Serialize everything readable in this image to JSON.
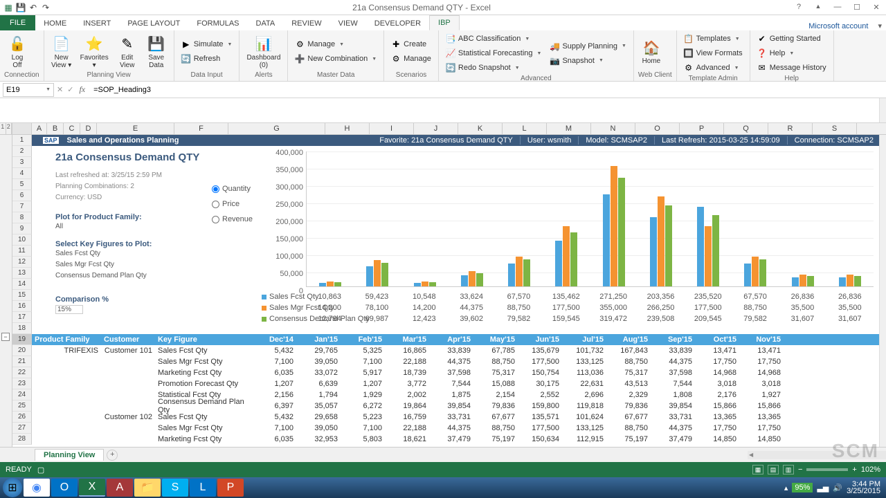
{
  "app": {
    "title": "21a Consensus Demand QTY - Excel",
    "account": "Microsoft account"
  },
  "qat": {
    "save": "💾",
    "undo": "↶",
    "redo": "↷"
  },
  "tabs": [
    "FILE",
    "HOME",
    "INSERT",
    "PAGE LAYOUT",
    "FORMULAS",
    "DATA",
    "REVIEW",
    "VIEW",
    "DEVELOPER",
    "IBP"
  ],
  "ribbon": {
    "groups": [
      {
        "label": "Connection",
        "big": [
          {
            "ic": "🔓",
            "t1": "Log",
            "t2": "Off"
          }
        ]
      },
      {
        "label": "Planning View",
        "big": [
          {
            "ic": "📄",
            "t1": "New",
            "t2": "View ▾"
          },
          {
            "ic": "⭐",
            "t1": "Favorites",
            "t2": "▾"
          },
          {
            "ic": "✎",
            "t1": "Edit",
            "t2": "View"
          },
          {
            "ic": "💾",
            "t1": "Save",
            "t2": "Data"
          }
        ]
      },
      {
        "label": "Data Input",
        "small": [
          {
            "ic": "▶",
            "tx": "Simulate",
            "dd": true
          },
          {
            "ic": "🔄",
            "tx": "Refresh"
          }
        ]
      },
      {
        "label": "Alerts",
        "big": [
          {
            "ic": "📊",
            "t1": "Dashboard",
            "t2": "(0)"
          }
        ]
      },
      {
        "label": "Master Data",
        "small": [
          {
            "ic": "⚙",
            "tx": "Manage",
            "dd": true
          },
          {
            "ic": "➕",
            "tx": "New Combination",
            "dd": true
          }
        ]
      },
      {
        "label": "Scenarios",
        "small": [
          {
            "ic": "✚",
            "tx": "Create"
          },
          {
            "ic": "⚙",
            "tx": "Manage"
          }
        ]
      },
      {
        "label": "Advanced",
        "small": [
          {
            "ic": "📑",
            "tx": "ABC Classification",
            "dd": true
          },
          {
            "ic": "📈",
            "tx": "Statistical Forecasting",
            "dd": true
          },
          {
            "ic": "🔄",
            "tx": "Redo Snapshot",
            "dd": true
          },
          {
            "ic": "🚚",
            "tx": "Supply Planning",
            "dd": true
          },
          {
            "ic": "📷",
            "tx": "Snapshot",
            "dd": true
          }
        ]
      },
      {
        "label": "Web Client",
        "big": [
          {
            "ic": "🏠",
            "t1": "Home",
            "t2": ""
          }
        ]
      },
      {
        "label": "Template Admin",
        "small": [
          {
            "ic": "📋",
            "tx": "Templates",
            "dd": true
          },
          {
            "ic": "🔲",
            "tx": "View Formats"
          },
          {
            "ic": "⚙",
            "tx": "Advanced",
            "dd": true
          }
        ]
      },
      {
        "label": "Help",
        "small": [
          {
            "ic": "✔",
            "tx": "Getting Started"
          },
          {
            "ic": "❓",
            "tx": "Help",
            "dd": true
          },
          {
            "ic": "✉",
            "tx": "Message History"
          }
        ]
      }
    ]
  },
  "formulabar": {
    "name": "E19",
    "formula": "=SOP_Heading3"
  },
  "colwidths": {
    "A": 22,
    "B": 24,
    "C": 24,
    "D": 24,
    "E": 112,
    "F": 78,
    "G": 140,
    "H": 64,
    "I": 64,
    "J": 64,
    "K": 64,
    "L": 64,
    "M": 64,
    "N": 64,
    "O": 64,
    "P": 64,
    "Q": 64,
    "R": 64,
    "S": 64
  },
  "cols": [
    "A",
    "B",
    "C",
    "D",
    "E",
    "F",
    "G",
    "H",
    "I",
    "J",
    "K",
    "L",
    "M",
    "N",
    "O",
    "P",
    "Q",
    "R",
    "S"
  ],
  "rows_vis": 28,
  "sap_header": {
    "brand": "SAP",
    "title": "Sales and Operations Planning",
    "fav": "Favorite:  21a Consensus Demand QTY",
    "user": "User:  wsmith",
    "model": "Model:  SCMSAP2",
    "refresh": "Last Refresh:  2015-03-25  14:59:09",
    "conn": "Connection:  SCMSAP2"
  },
  "report": {
    "title": "21a Consensus Demand QTY",
    "meta": [
      "Last refreshed at: 3/25/15 2:59 PM",
      "Planning Combinations: 2",
      "Currency: USD"
    ],
    "plot_lbl": "Plot for Product Family:",
    "plot_val": "All",
    "kf_lbl": "Select Key Figures to Plot:",
    "kf": [
      "Sales Fcst Qty",
      "Sales Mgr Fcst Qty",
      "Consensus Demand Plan Qty"
    ],
    "comp_lbl": "Comparison %",
    "comp_val": "15%",
    "radios": [
      "Quantity",
      "Price",
      "Revenue"
    ],
    "legend": [
      "Sales Fcst Qty",
      "Sales Mgr Fcst Qty",
      "Consensus Demand Plan Qty"
    ]
  },
  "chart_data": {
    "type": "bar",
    "ylim": [
      0,
      400000
    ],
    "yticks": [
      "400,000",
      "350,000",
      "300,000",
      "250,000",
      "200,000",
      "150,000",
      "100,000",
      "50,000",
      "0"
    ],
    "categories": [
      "Dec'14",
      "Jan'15",
      "Feb'15",
      "Mar'15",
      "Apr'15",
      "May'15",
      "Jun'15",
      "Jul'15",
      "Aug'15",
      "Sep'15",
      "Oct'15",
      "Nov'15"
    ],
    "series": [
      {
        "name": "Sales Fcst Qty",
        "color": "#4ba5dd",
        "values": [
          10863,
          59423,
          10548,
          33624,
          67570,
          135462,
          271250,
          203356,
          235520,
          67570,
          26836,
          26836
        ]
      },
      {
        "name": "Sales Mgr Fcst Qty",
        "color": "#f59331",
        "values": [
          14200,
          78100,
          14200,
          44375,
          88750,
          177500,
          355000,
          266250,
          177500,
          88750,
          35500,
          35500
        ]
      },
      {
        "name": "Consensus Demand Plan Qty",
        "color": "#7db544",
        "values": [
          12794,
          69987,
          12423,
          39602,
          79582,
          159545,
          319472,
          239508,
          209545,
          79582,
          31607,
          31607
        ]
      }
    ]
  },
  "table": {
    "hdr": [
      "Product Family",
      "Customer",
      "Key Figure",
      "Dec'14",
      "Jan'15",
      "Feb'15",
      "Mar'15",
      "Apr'15",
      "May'15",
      "Jun'15",
      "Jul'15",
      "Aug'15",
      "Sep'15",
      "Oct'15",
      "Nov'15"
    ],
    "rows": [
      {
        "pf": "TRIFEXIS",
        "cust": "Customer 101",
        "kf": "Sales Fcst Qty",
        "v": [
          "5,432",
          "29,765",
          "5,325",
          "16,865",
          "33,839",
          "67,785",
          "135,679",
          "101,732",
          "167,843",
          "33,839",
          "13,471",
          "13,471"
        ]
      },
      {
        "pf": "",
        "cust": "",
        "kf": "Sales Mgr Fcst Qty",
        "v": [
          "7,100",
          "39,050",
          "7,100",
          "22,188",
          "44,375",
          "88,750",
          "177,500",
          "133,125",
          "88,750",
          "44,375",
          "17,750",
          "17,750"
        ]
      },
      {
        "pf": "",
        "cust": "",
        "kf": "Marketing Fcst Qty",
        "v": [
          "6,035",
          "33,072",
          "5,917",
          "18,739",
          "37,598",
          "75,317",
          "150,754",
          "113,036",
          "75,317",
          "37,598",
          "14,968",
          "14,968"
        ]
      },
      {
        "pf": "",
        "cust": "",
        "kf": "Promotion Forecast Qty",
        "v": [
          "1,207",
          "6,639",
          "1,207",
          "3,772",
          "7,544",
          "15,088",
          "30,175",
          "22,631",
          "43,513",
          "7,544",
          "3,018",
          "3,018"
        ]
      },
      {
        "pf": "",
        "cust": "",
        "kf": "Statistical Fcst Qty",
        "v": [
          "2,156",
          "1,794",
          "1,929",
          "2,002",
          "1,875",
          "2,154",
          "2,552",
          "2,696",
          "2,329",
          "1,808",
          "2,176",
          "1,927"
        ]
      },
      {
        "pf": "",
        "cust": "",
        "kf": "Consensus Demand Plan Qty",
        "v": [
          "6,397",
          "35,057",
          "6,272",
          "19,864",
          "39,854",
          "79,836",
          "159,800",
          "119,818",
          "79,836",
          "39,854",
          "15,866",
          "15,866"
        ]
      },
      {
        "pf": "",
        "cust": "Customer 102",
        "kf": "Sales Fcst Qty",
        "v": [
          "5,432",
          "29,658",
          "5,223",
          "16,759",
          "33,731",
          "67,677",
          "135,571",
          "101,624",
          "67,677",
          "33,731",
          "13,365",
          "13,365"
        ]
      },
      {
        "pf": "",
        "cust": "",
        "kf": "Sales Mgr Fcst Qty",
        "v": [
          "7,100",
          "39,050",
          "7,100",
          "22,188",
          "44,375",
          "88,750",
          "177,500",
          "133,125",
          "88,750",
          "44,375",
          "17,750",
          "17,750"
        ]
      },
      {
        "pf": "",
        "cust": "",
        "kf": "Marketing Fcst Qty",
        "v": [
          "6,035",
          "32,953",
          "5,803",
          "18,621",
          "37,479",
          "75,197",
          "150,634",
          "112,915",
          "75,197",
          "37,479",
          "14,850",
          "14,850"
        ]
      }
    ]
  },
  "sheet": {
    "name": "Planning View"
  },
  "status": {
    "ready": "READY",
    "zoom": "102%",
    "battery": "95%",
    "time": "3:44 PM",
    "date": "3/25/2015"
  }
}
